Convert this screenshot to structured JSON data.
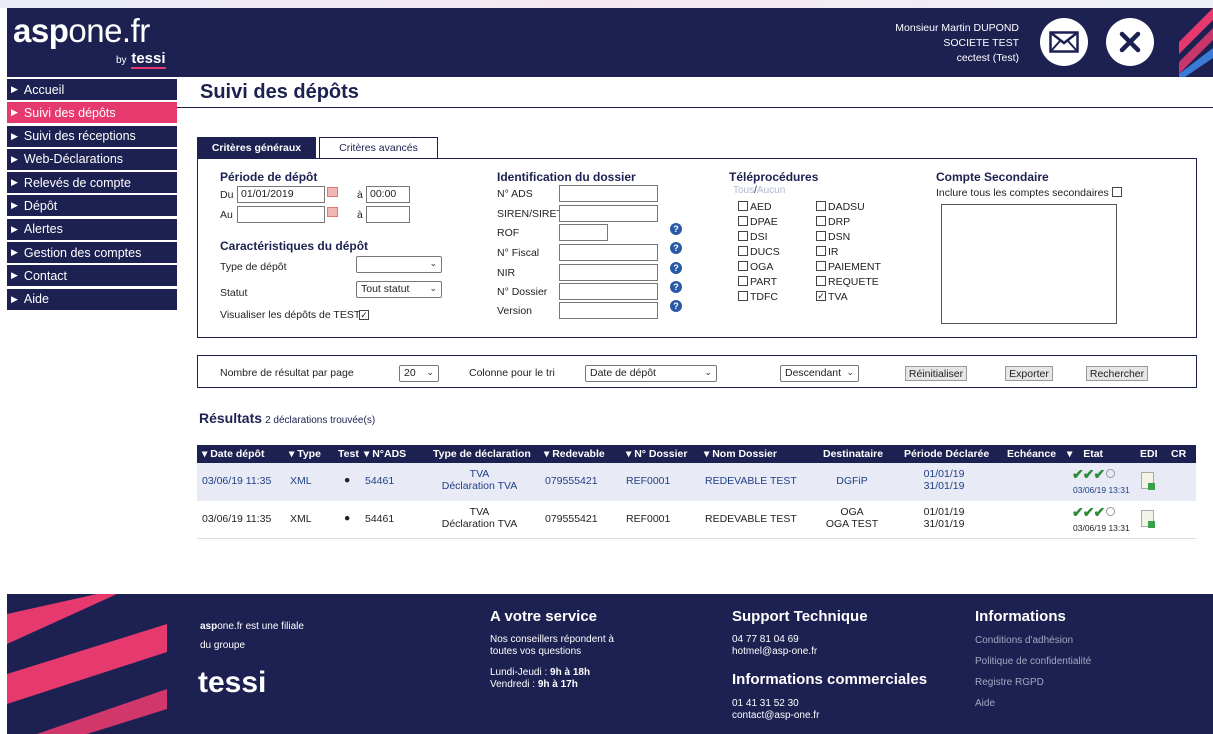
{
  "header": {
    "logo": {
      "part1": "asp",
      "part2": "one.fr",
      "by": "by",
      "brand": "tessi"
    },
    "user": {
      "name": "Monsieur Martin DUPOND",
      "company": "SOCIETE TEST",
      "login": "cectest (Test)"
    }
  },
  "sidebar": {
    "items": [
      {
        "label": "Accueil"
      },
      {
        "label": "Suivi des dépôts"
      },
      {
        "label": "Suivi des réceptions"
      },
      {
        "label": "Web-Déclarations"
      },
      {
        "label": "Relevés de compte"
      },
      {
        "label": "Dépôt"
      },
      {
        "label": "Alertes"
      },
      {
        "label": "Gestion des comptes"
      },
      {
        "label": "Contact"
      },
      {
        "label": "Aide"
      }
    ]
  },
  "page": {
    "title": "Suivi des dépôts"
  },
  "tabs": [
    {
      "label": "Critères généraux"
    },
    {
      "label": "Critères avancés"
    }
  ],
  "periode": {
    "title": "Période de dépôt",
    "du_label": "Du",
    "du_value": "01/01/2019",
    "a1_label": "à",
    "a1_value": "00:00",
    "au_label": "Au",
    "au_value": "",
    "a2_label": "à",
    "a2_value": ""
  },
  "caracteristiques": {
    "title": "Caractéristiques du dépôt",
    "type_label": "Type de dépôt",
    "type_value": "",
    "statut_label": "Statut",
    "statut_value": "Tout statut",
    "test_label": "Visualiser les dépôts de TEST"
  },
  "identification": {
    "title": "Identification du dossier",
    "fields": [
      {
        "label": "N° ADS",
        "value": ""
      },
      {
        "label": "SIREN/SIRET",
        "value": ""
      },
      {
        "label": "ROF",
        "value": ""
      },
      {
        "label": "N° Fiscal",
        "value": ""
      },
      {
        "label": "NIR",
        "value": ""
      },
      {
        "label": "N° Dossier",
        "value": ""
      },
      {
        "label": "Version",
        "value": ""
      }
    ]
  },
  "teleprocedures": {
    "title": "Téléprocédures",
    "tous": "Tous",
    "sep": "/",
    "aucun": "Aucun",
    "col1": [
      "AED",
      "DPAE",
      "DSI",
      "DUCS",
      "OGA",
      "PART",
      "TDFC"
    ],
    "col2": [
      "DADSU",
      "DRP",
      "DSN",
      "IR",
      "PAIEMENT",
      "REQUETE",
      "TVA"
    ]
  },
  "compte": {
    "title": "Compte Secondaire",
    "label": "Inclure tous les comptes secondaires"
  },
  "options": {
    "per_page_label": "Nombre de résultat par page",
    "per_page_value": "20",
    "sort_label": "Colonne pour le tri",
    "sort_value": "Date de dépôt",
    "order_value": "Descendant",
    "reset": "Réinitialiser",
    "export": "Exporter",
    "search": "Rechercher"
  },
  "results": {
    "title": "Résultats",
    "count": "2 déclarations trouvée(s)",
    "headers": [
      "Date dépôt",
      "Type",
      "Test",
      "N°ADS",
      "Type de déclaration",
      "Redevable",
      "N° Dossier",
      "Nom Dossier",
      "Destinataire",
      "Période Déclarée",
      "Echéance",
      "Etat",
      "EDI",
      "CR"
    ],
    "rows": [
      {
        "date": "03/06/19 11:35",
        "type": "XML",
        "test": "●",
        "ads": "54461",
        "decl1": "TVA",
        "decl2": "Déclaration TVA",
        "redevable": "079555421",
        "dossier": "REF0001",
        "nom": "REDEVABLE TEST",
        "dest1": "DGFiP",
        "dest2": "",
        "periode1": "01/01/19",
        "periode2": "31/01/19",
        "etat_checks": "✔✔✔",
        "etat_date": "03/06/19 13:31"
      },
      {
        "date": "03/06/19 11:35",
        "type": "XML",
        "test": "●",
        "ads": "54461",
        "decl1": "TVA",
        "decl2": "Déclaration TVA",
        "redevable": "079555421",
        "dossier": "REF0001",
        "nom": "REDEVABLE TEST",
        "dest1": "OGA",
        "dest2": "OGA TEST",
        "periode1": "01/01/19",
        "periode2": "31/01/19",
        "etat_checks": "✔✔✔",
        "etat_date": "03/06/19 13:31"
      }
    ]
  },
  "footer": {
    "filiale_bold": "asp",
    "filiale_rest": "one.fr est une filiale",
    "groupe": "du groupe",
    "brand": "tessi",
    "service_title": "A votre service",
    "service_l1": "Nos conseillers répondent à",
    "service_l2": "toutes vos questions",
    "hours_l1_label": "Lundi-Jeudi : ",
    "hours_l1_value": "9h à 18h",
    "hours_l2_label": "Vendredi : ",
    "hours_l2_value": "9h à 17h",
    "support_title": "Support Technique",
    "support_phone": "04 77 81 04 69",
    "support_mail": "hotmel@asp-one.fr",
    "commercial_title": "Informations commerciales",
    "commercial_phone": "01 41 31 52 30",
    "commercial_mail": "contact@asp-one.fr",
    "info_title": "Informations",
    "info_links": [
      "Conditions d'adhésion",
      "Politique de confidentialité",
      "Registre RGPD",
      "Aide"
    ]
  },
  "colors": {
    "navy": "#1d2151",
    "pink": "#e63a6e",
    "blue": "#1f3f86",
    "green": "#2e8b3a"
  }
}
